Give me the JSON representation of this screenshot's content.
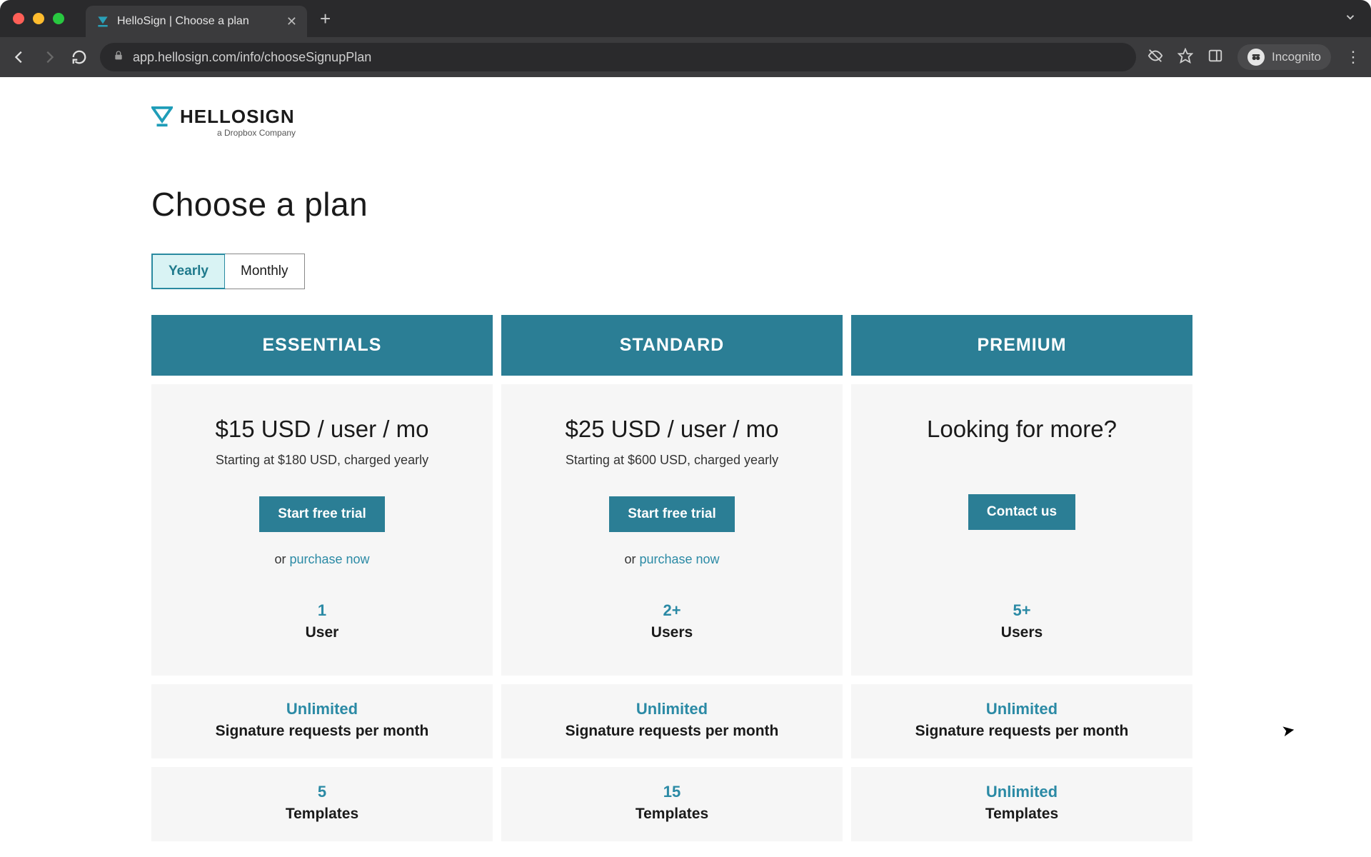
{
  "browser": {
    "tab_title": "HelloSign | Choose a plan",
    "url": "app.hellosign.com/info/chooseSignupPlan",
    "incognito_label": "Incognito"
  },
  "logo": {
    "brand": "HELLOSIGN",
    "tagline": "a Dropbox Company"
  },
  "page": {
    "title": "Choose a plan"
  },
  "toggle": {
    "yearly": "Yearly",
    "monthly": "Monthly",
    "active": "yearly"
  },
  "plans": [
    {
      "name": "ESSENTIALS",
      "price": "$15 USD / user / mo",
      "price_sub": "Starting at $180 USD, charged yearly",
      "cta": "Start free trial",
      "or_text": "or ",
      "purchase_link": "purchase now",
      "users_value": "1",
      "users_label": "User"
    },
    {
      "name": "STANDARD",
      "price": "$25 USD / user / mo",
      "price_sub": "Starting at $600 USD, charged yearly",
      "cta": "Start free trial",
      "or_text": "or ",
      "purchase_link": "purchase now",
      "users_value": "2+",
      "users_label": "Users"
    },
    {
      "name": "PREMIUM",
      "price": "Looking for more?",
      "price_sub": "",
      "cta": "Contact us",
      "or_text": "",
      "purchase_link": "",
      "users_value": "5+",
      "users_label": "Users"
    }
  ],
  "features": [
    {
      "label": "Signature requests per month",
      "values": [
        "Unlimited",
        "Unlimited",
        "Unlimited"
      ]
    },
    {
      "label": "Templates",
      "values": [
        "5",
        "15",
        "Unlimited"
      ]
    }
  ]
}
